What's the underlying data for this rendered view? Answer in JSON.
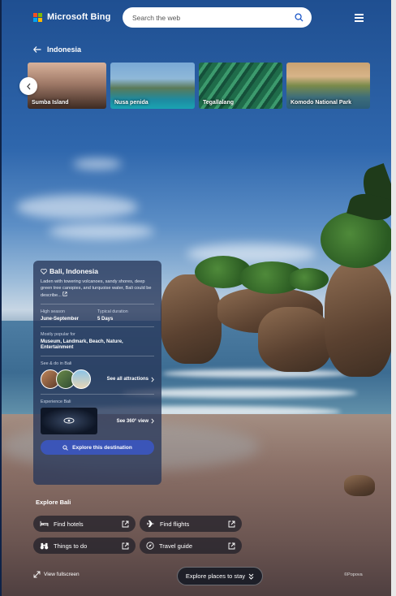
{
  "header": {
    "brand": "Microsoft Bing",
    "search_placeholder": "Search the web",
    "logo_colors": [
      "#f25022",
      "#7fba00",
      "#00a4ef",
      "#ffb900"
    ]
  },
  "breadcrumb": {
    "label": "Indonesia"
  },
  "carousel": {
    "items": [
      {
        "label": "Sumba Island"
      },
      {
        "label": "Nusa penida"
      },
      {
        "label": "Tegallalang"
      },
      {
        "label": "Komodo National Park"
      }
    ]
  },
  "panel": {
    "title": "Bali, Indonesia",
    "description": "Laden with towering volcanoes, sandy shores, deep green tree canopies, and turquoise water, Bali could be describe...",
    "high_season_label": "High season",
    "high_season_value": "June-September",
    "duration_label": "Typical duration",
    "duration_value": "5 Days",
    "popular_label": "Mostly popular for",
    "popular_value": "Museum, Landmark, Beach, Nature, Entertainment",
    "see_do_label": "See & do in Bali",
    "see_all": "See all attractions",
    "experience_label": "Experience Bali",
    "see_360": "See 360° view",
    "explore_button": "Explore this destination",
    "accent": "#3b55b8"
  },
  "explore": {
    "title": "Explore Bali",
    "hotels": "Find hotels",
    "flights": "Find flights",
    "things": "Things to do",
    "guide": "Travel guide"
  },
  "footer": {
    "fullscreen": "View fullscreen",
    "stay": "Explore places to stay",
    "credit": "©Popova"
  }
}
